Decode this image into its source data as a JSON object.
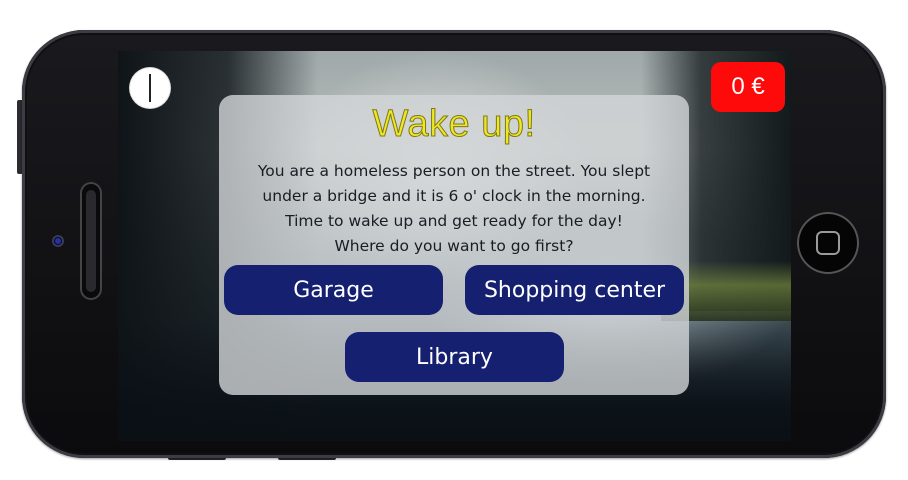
{
  "money": {
    "label": "0 €"
  },
  "dialog": {
    "title": "Wake up!",
    "lines": [
      "You are a homeless person on the street. You slept",
      "under a bridge and it is 6 o' clock in the morning.",
      "Time to wake up and get ready for the day!",
      "Where do you want to go first?"
    ]
  },
  "choices": {
    "garage": "Garage",
    "shopping": "Shopping center",
    "library": "Library"
  },
  "icons": {
    "clock": "clock-icon",
    "home": "home-button-icon"
  },
  "colors": {
    "title": "#f0e628",
    "button": "#152070",
    "money_badge": "#ff0a0a"
  }
}
